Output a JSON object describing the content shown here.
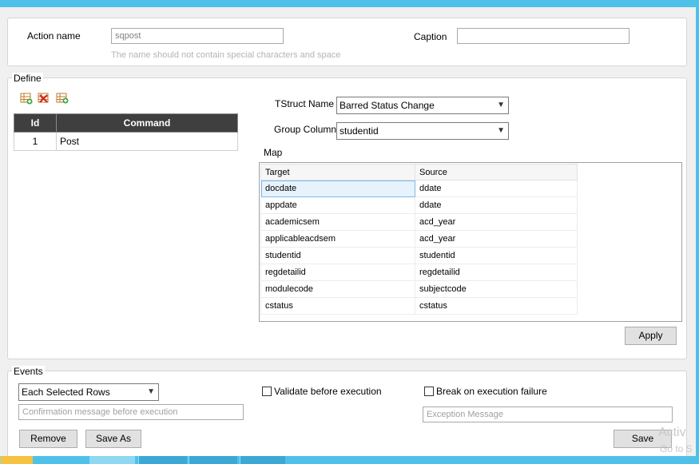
{
  "action": {
    "name_label": "Action name",
    "name_value": "sqpost",
    "name_hint": "The name should not contain special characters and space",
    "caption_label": "Caption",
    "caption_value": ""
  },
  "define": {
    "legend": "Define",
    "commands": {
      "headers": [
        "Id",
        "Command"
      ],
      "rows": [
        {
          "id": "1",
          "command": "Post"
        }
      ]
    },
    "tstruct_label": "TStruct Name",
    "tstruct_value": "Barred Status Change",
    "group_label": "Group Column",
    "group_value": "studentid",
    "map_label": "Map",
    "map": {
      "headers": [
        "Target",
        "Source"
      ],
      "rows": [
        {
          "target": "docdate",
          "source": "ddate"
        },
        {
          "target": "appdate",
          "source": "ddate"
        },
        {
          "target": "academicsem",
          "source": "acd_year"
        },
        {
          "target": "applicableacdsem",
          "source": "acd_year"
        },
        {
          "target": "studentid",
          "source": "studentid"
        },
        {
          "target": "regdetailid",
          "source": "regdetailid"
        },
        {
          "target": "modulecode",
          "source": "subjectcode"
        },
        {
          "target": "cstatus",
          "source": "cstatus"
        }
      ]
    },
    "apply_label": "Apply"
  },
  "events": {
    "legend": "Events",
    "mode_value": "Each Selected Rows",
    "confirm_placeholder": "Confirmation message before execution",
    "validate_label": "Validate before execution",
    "break_label": "Break on execution failure",
    "exception_placeholder": "Exception Message"
  },
  "buttons": {
    "remove": "Remove",
    "save_as": "Save As",
    "save": "Save"
  },
  "watermark": {
    "line1": "Activ",
    "line2": "Go to S"
  },
  "colors": {
    "desktop": "#4fc1e9",
    "grid_header": "#3f3f3f",
    "selection": "#e7f3fc"
  }
}
